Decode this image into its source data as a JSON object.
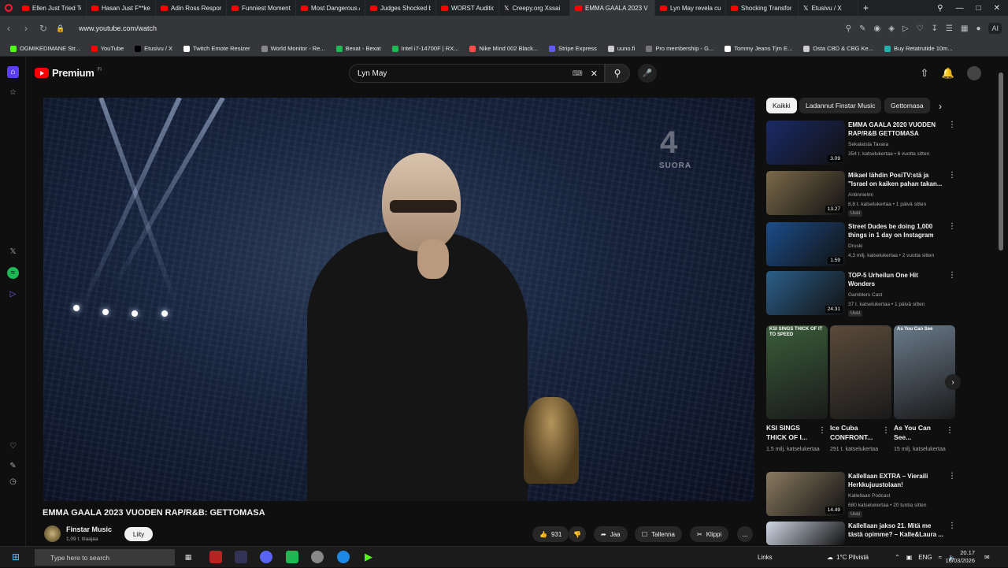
{
  "browser": {
    "tabs": [
      {
        "title": "Ellen Just Tried To C",
        "icon": "youtube-icon"
      },
      {
        "title": "Hasan Just F**ked",
        "icon": "youtube-icon"
      },
      {
        "title": "Adin Ross Respond",
        "icon": "youtube-icon"
      },
      {
        "title": "Funniest Moment",
        "icon": "youtube-icon"
      },
      {
        "title": "Most Dangerous A",
        "icon": "youtube-icon"
      },
      {
        "title": "Judges Shocked by",
        "icon": "youtube-icon"
      },
      {
        "title": "WORST Auditions",
        "icon": "youtube-icon"
      },
      {
        "title": "Creepy.org Xssai",
        "icon": "x-icon"
      },
      {
        "title": "EMMA GAALA 2023 V",
        "icon": "youtube-icon",
        "active": true
      },
      {
        "title": "Lyn May revela cu",
        "icon": "youtube-icon"
      },
      {
        "title": "Shocking Transfor",
        "icon": "youtube-icon"
      },
      {
        "title": "Etusivu / X",
        "icon": "x-icon"
      }
    ],
    "new_tab": "+",
    "url": "www.youtube.com/watch",
    "ai_label": "AI"
  },
  "bookmarks": [
    {
      "label": "OGMIKEDIMANE Str...",
      "color": "#53fc18"
    },
    {
      "label": "YouTube",
      "color": "#ff0000"
    },
    {
      "label": "Etusivu / X",
      "color": "#000000"
    },
    {
      "label": "Twitch Emote Resizer",
      "color": "#ffffff"
    },
    {
      "label": "World Monitor - Re...",
      "color": "#888888"
    },
    {
      "label": "Bexat - Bexat",
      "color": "#1db954"
    },
    {
      "label": "Intel i7-14700F | RX...",
      "color": "#1db954"
    },
    {
      "label": "Nike Mind 002 Black...",
      "color": "#ff4d4d"
    },
    {
      "label": "Stripe Express",
      "color": "#635bff"
    },
    {
      "label": "uuno.fi",
      "color": "#cccccc"
    },
    {
      "label": "Pro membership - G...",
      "color": "#777777"
    },
    {
      "label": "Tommy Jeans Tjm E...",
      "color": "#ffffff"
    },
    {
      "label": "Osta CBD & CBG Ke...",
      "color": "#cccccc"
    },
    {
      "label": "Buy Retatrutide 10m...",
      "color": "#20b2aa"
    }
  ],
  "youtube": {
    "brand": "Premium",
    "brand_sup": "FI",
    "search_value": "Lyn May",
    "video": {
      "channel_bug": "4",
      "channel_bug_sub": "SUORA"
    },
    "title": "EMMA GAALA 2023 VUODEN RAP/R&B: GETTOMASA",
    "channel": {
      "name": "Finstar Music",
      "subs": "1,09 t. tilaajaa",
      "join": "Liity"
    },
    "actions": {
      "likes": "931",
      "share": "Jaa",
      "save": "Tallenna",
      "clip": "Klippi",
      "more": "..."
    },
    "chips": [
      "Kaikki",
      "Ladannut Finstar Music",
      "Gettomasa"
    ],
    "recommendations": [
      {
        "title": "EMMA GAALA 2020 VUODEN RAP/R&B GETTOMASA",
        "channel": "Sekalaista Tavara",
        "meta": "354 t. katselukertaa • 6 vuotta sitten",
        "duration": "3.09",
        "badge": "",
        "color": "#1a2a66"
      },
      {
        "title": "Mikael lähdin PosiTV:stä ja \"Israel on kaiken pahan takan...",
        "channel": "Antinnielmi",
        "meta": "8,8 t. katselukertaa • 1 päivä sitten",
        "duration": "13.27",
        "badge": "Uusi",
        "color": "#7b6a4a"
      },
      {
        "title": "Street Dudes be doing 1,000 things in 1 day on Instagram",
        "channel": "Druski",
        "meta": "4,3 milj. katselukertaa • 2 vuotta sitten",
        "duration": "1.59",
        "badge": "",
        "color": "#1b4d8a"
      },
      {
        "title": "TOP-5 Urheilun One Hit Wonders",
        "channel": "Gamblers Cast",
        "meta": "37 t. katselukertaa • 1 päivä sitten",
        "duration": "24.31",
        "badge": "Uusi",
        "color": "#2b5f8a"
      },
      {
        "title": "Kallellaan EXTRA – Vieraili Herkkujuustolaan!",
        "channel": "Kallellaan Podcast",
        "meta": "680 katselukertaa • 20 tuntia sitten",
        "duration": "14.49",
        "badge": "Uusi",
        "color": "#8a7a60"
      },
      {
        "title": "Kallellaan jakso 21. Mitä me tästä opimme? – Kalle&Laura ...",
        "channel": "",
        "meta": "",
        "duration": "",
        "badge": "",
        "color": "#cfd8e6"
      }
    ],
    "shorts": [
      {
        "title": "KSI SINGS THICK OF I...",
        "views": "1,5 milj. katselukertaa",
        "overlay": "KSI SINGS THICK OF IT TO SPEED",
        "color": "#3a5d3a"
      },
      {
        "title": "Ice Cuba CONFRONT...",
        "views": "291 t. katselukertaa",
        "overlay": "",
        "color": "#5a4a3a"
      },
      {
        "title": "As You Can See...",
        "views": "15 milj. katselukertaa",
        "overlay": "As You Can See",
        "color": "#6a7a8a"
      }
    ]
  },
  "taskbar": {
    "search_placeholder": "Type here to search",
    "links": "Links",
    "weather": "1°C Pilvistä",
    "lang": "ENG",
    "time": "20.17",
    "date": "16/03/2026"
  }
}
